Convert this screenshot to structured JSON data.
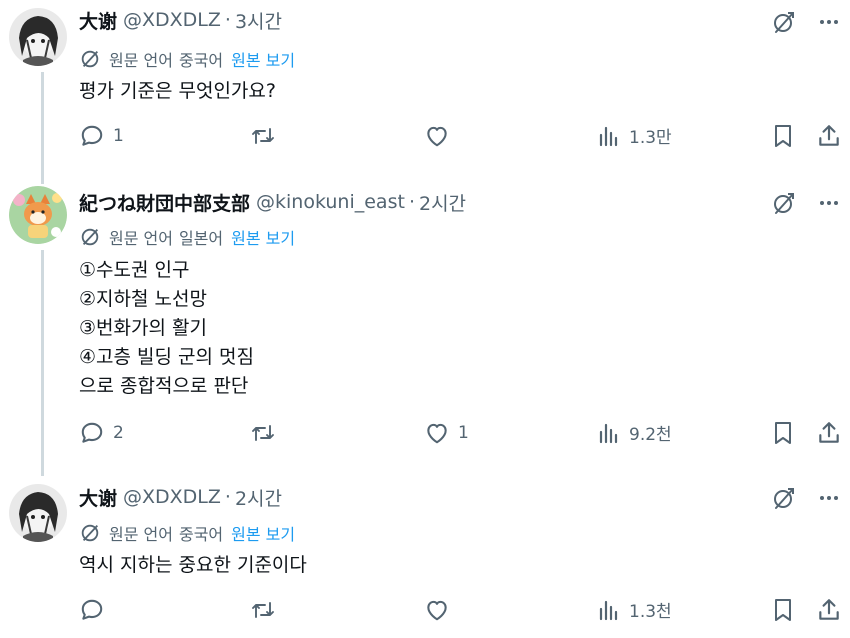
{
  "translate_label": "원문 언어",
  "show_original_label": "원본 보기",
  "tweets": [
    {
      "name": "大谢",
      "handle": "@XDXDLZ",
      "separator": "·",
      "time": "3시간",
      "source_language": "중국어",
      "body": "평가 기준은 무엇인가요?",
      "replies": "1",
      "retweets": "",
      "likes": "",
      "views": "1.3만"
    },
    {
      "name": "紀つね財団中部支部",
      "handle": "@kinokuni_east",
      "separator": "·",
      "time": "2시간",
      "source_language": "일본어",
      "body": "①수도권 인구\n②지하철 노선망\n③번화가의 활기\n④고층 빌딩 군의 멋짐\n으로 종합적으로 판단",
      "replies": "2",
      "retweets": "",
      "likes": "1",
      "views": "9.2천"
    },
    {
      "name": "大谢",
      "handle": "@XDXDLZ",
      "separator": "·",
      "time": "2시간",
      "source_language": "중국어",
      "body": "역시 지하는 중요한 기준이다",
      "replies": "",
      "retweets": "",
      "likes": "",
      "views": "1.3천"
    }
  ],
  "colors": {
    "text": "#0f1419",
    "secondary": "#536471",
    "link": "#1d9bf0",
    "thread_line": "#cfd9de"
  },
  "icons": [
    "grok-slash-icon",
    "more-icon",
    "translate-icon",
    "reply-icon",
    "retweet-icon",
    "like-icon",
    "views-icon",
    "bookmark-icon",
    "share-icon"
  ]
}
